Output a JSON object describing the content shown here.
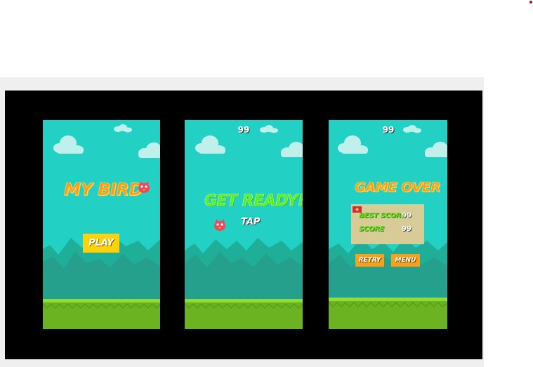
{
  "screens": {
    "menu": {
      "title": "MY BIRD",
      "play_label": "PLAY"
    },
    "ready": {
      "score": "99",
      "title": "GET READY!",
      "tap_label": "TAP"
    },
    "gameover": {
      "score": "99",
      "title": "GAME OVER",
      "best_score_label": "BEST SCORE",
      "best_score_value": "99",
      "score_label": "SCORE",
      "score_value": "99",
      "retry_label": "RETRY",
      "menu_label": "MENU"
    }
  },
  "colors": {
    "sky": "#23d1c4",
    "mountain": "#1f9e8f",
    "ground": "#6cb321",
    "grass": "#8fdc39",
    "title_orange": "#ff9a1f",
    "title_green": "#52f02e",
    "button_yellow": "#ffd10a",
    "button_orange": "#f5a11c",
    "panel": "#d8cc96",
    "bird": "#f2465b"
  }
}
